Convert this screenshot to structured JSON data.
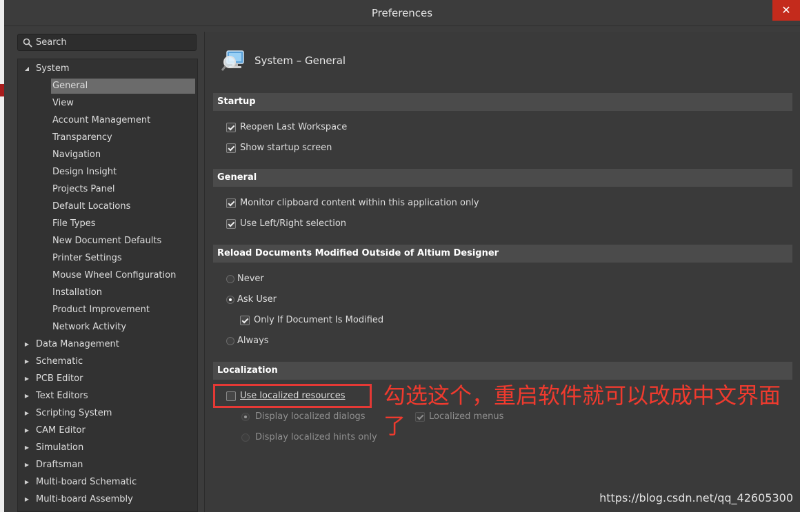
{
  "window": {
    "title": "Preferences",
    "close_glyph": "✕"
  },
  "search": {
    "placeholder": "Search",
    "icon": "search-icon"
  },
  "tree": {
    "system": {
      "label": "System",
      "expanded": true,
      "children": [
        {
          "label": "General",
          "selected": true
        },
        {
          "label": "View"
        },
        {
          "label": "Account Management"
        },
        {
          "label": "Transparency"
        },
        {
          "label": "Navigation"
        },
        {
          "label": "Design Insight"
        },
        {
          "label": "Projects Panel"
        },
        {
          "label": "Default Locations"
        },
        {
          "label": "File Types"
        },
        {
          "label": "New Document Defaults"
        },
        {
          "label": "Printer Settings"
        },
        {
          "label": "Mouse Wheel Configuration"
        },
        {
          "label": "Installation"
        },
        {
          "label": "Product Improvement"
        },
        {
          "label": "Network Activity"
        }
      ]
    },
    "groups": [
      {
        "label": "Data Management"
      },
      {
        "label": "Schematic"
      },
      {
        "label": "PCB Editor"
      },
      {
        "label": "Text Editors"
      },
      {
        "label": "Scripting System"
      },
      {
        "label": "CAM Editor"
      },
      {
        "label": "Simulation"
      },
      {
        "label": "Draftsman"
      },
      {
        "label": "Multi-board Schematic"
      },
      {
        "label": "Multi-board Assembly"
      }
    ]
  },
  "page": {
    "title": "System – General",
    "icon": "monitor-magnifier-icon",
    "sections": {
      "startup": {
        "title": "Startup",
        "options": [
          {
            "label": "Reopen Last Workspace",
            "checked": true
          },
          {
            "label": "Show startup screen",
            "checked": true
          }
        ]
      },
      "general": {
        "title": "General",
        "options": [
          {
            "label": "Monitor clipboard content within this application only",
            "checked": true
          },
          {
            "label": "Use Left/Right selection",
            "checked": true
          }
        ]
      },
      "reload": {
        "title": "Reload Documents Modified Outside of Altium Designer",
        "never": {
          "label": "Never",
          "selected": false
        },
        "ask_user": {
          "label": "Ask User",
          "selected": true
        },
        "only_if_modified": {
          "label": "Only If Document Is Modified",
          "checked": true
        },
        "always": {
          "label": "Always",
          "selected": false
        }
      },
      "localization": {
        "title": "Localization",
        "use_localized": {
          "label": "Use localized resources",
          "checked": false
        },
        "display_dialogs": {
          "label": "Display localized dialogs",
          "selected": true,
          "enabled": false
        },
        "localized_menus": {
          "label": "Localized menus",
          "checked": true,
          "enabled": false
        },
        "display_hints": {
          "label": "Display localized hints only",
          "selected": false,
          "enabled": false
        }
      }
    }
  },
  "annotation": {
    "text": "勾选这个，重启软件就可以改成中文界面了",
    "color": "#f03a2e"
  },
  "watermark": "https://blog.csdn.net/qq_42605300",
  "colors": {
    "selection": "#6b6b6b",
    "section_bg": "#4b4b4b",
    "close_bg": "#c42b1c"
  }
}
